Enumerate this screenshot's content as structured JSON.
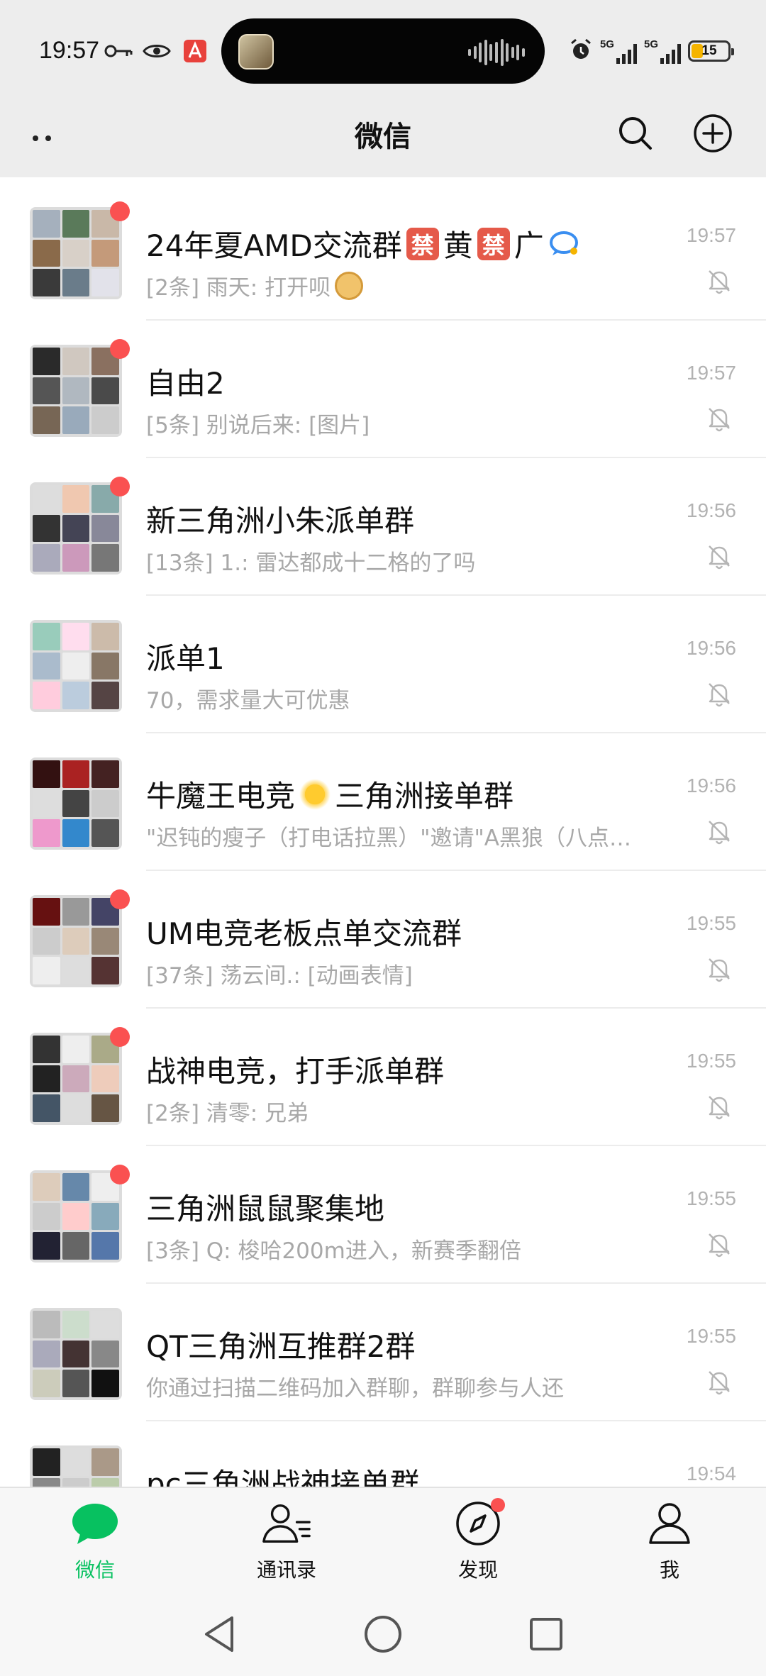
{
  "status_bar": {
    "time": "19:57",
    "network1": "5G",
    "network2": "5G",
    "battery": "15",
    "battery_color": "#f5b400"
  },
  "header": {
    "title": "微信",
    "more_icon": "more-dots-icon",
    "search_icon": "search-icon",
    "add_icon": "plus-circle-icon"
  },
  "chats": [
    {
      "name": "24年夏AMD交流群",
      "name_suffix": [
        "禁",
        "黄",
        "禁",
        "广"
      ],
      "preview": "[2条] 雨天: 打开呗",
      "time": "19:57",
      "unread_dot": true,
      "muted": true
    },
    {
      "name": "自由2",
      "preview": "[5条] 别说后来: [图片]",
      "time": "19:57",
      "unread_dot": true,
      "muted": true
    },
    {
      "name": "新三角洲小朱派单群",
      "preview": "[13条] 1.: 雷达都成十二格的了吗",
      "time": "19:56",
      "unread_dot": true,
      "muted": true
    },
    {
      "name": "派单1",
      "preview": "70，需求量大可优惠",
      "time": "19:56",
      "unread_dot": false,
      "muted": true
    },
    {
      "name_prefix": "牛魔王电竞",
      "name": "三角洲接单群",
      "preview": "\"迟钝的瘦子（打电话拉黑）\"邀请\"A黑狼（八点…",
      "time": "19:56",
      "unread_dot": false,
      "muted": true
    },
    {
      "name": "UM电竞老板点单交流群",
      "preview": "[37条] 荡云间.: [动画表情]",
      "time": "19:55",
      "unread_dot": true,
      "muted": true
    },
    {
      "name": "战神电竞，打手派单群",
      "preview": "[2条] 清零: 兄弟",
      "time": "19:55",
      "unread_dot": true,
      "muted": true
    },
    {
      "name": "三角洲鼠鼠聚集地",
      "preview": "[3条] Q: 梭哈200m进入，新赛季翻倍",
      "time": "19:55",
      "unread_dot": true,
      "muted": true
    },
    {
      "name": "QT三角洲互推群2群",
      "preview": "你通过扫描二维码加入群聊，群聊参与人还",
      "time": "19:55",
      "unread_dot": false,
      "muted": true
    },
    {
      "name": "pc三角洲战神接单群",
      "preview": "",
      "time": "19:54",
      "unread_dot": false,
      "muted": true
    }
  ],
  "tabs": [
    {
      "label": "微信",
      "icon": "chat-bubble-icon",
      "active": true
    },
    {
      "label": "通讯录",
      "icon": "contacts-icon",
      "active": false
    },
    {
      "label": "发现",
      "icon": "compass-icon",
      "active": false,
      "dot": true
    },
    {
      "label": "我",
      "icon": "person-icon",
      "active": false
    }
  ],
  "colors": {
    "accent": "#07c160",
    "unread": "#fa5151",
    "muted_text": "#a8a8a8"
  }
}
